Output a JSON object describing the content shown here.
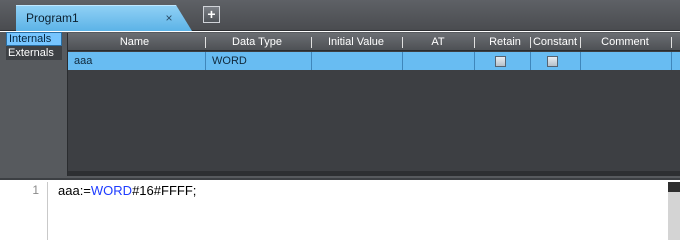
{
  "tabs": [
    {
      "label": "Program1",
      "close_glyph": "×"
    }
  ],
  "add_tab_glyph": "+",
  "side_tabs": [
    {
      "label": "Internals",
      "active": true
    },
    {
      "label": "Externals",
      "active": false
    }
  ],
  "grid": {
    "columns": [
      "Name",
      "Data Type",
      "Initial Value",
      "AT",
      "Retain",
      "Constant",
      "Comment"
    ],
    "rows": [
      {
        "name": "aaa",
        "data_type": "WORD",
        "initial_value": "",
        "at": "",
        "retain": false,
        "constant": false,
        "comment": ""
      }
    ]
  },
  "editor": {
    "line_number": "1",
    "code_before": "aaa:=",
    "code_keyword": "WORD",
    "code_after": "#16#FFFF;"
  },
  "colors": {
    "selected_row": "#68bcf2",
    "active_tab": "#76c5ff",
    "keyword": "#1e3cff"
  },
  "icons": {
    "close": "close-icon",
    "add": "plus-icon",
    "checkbox": "checkbox-unchecked-icon"
  }
}
